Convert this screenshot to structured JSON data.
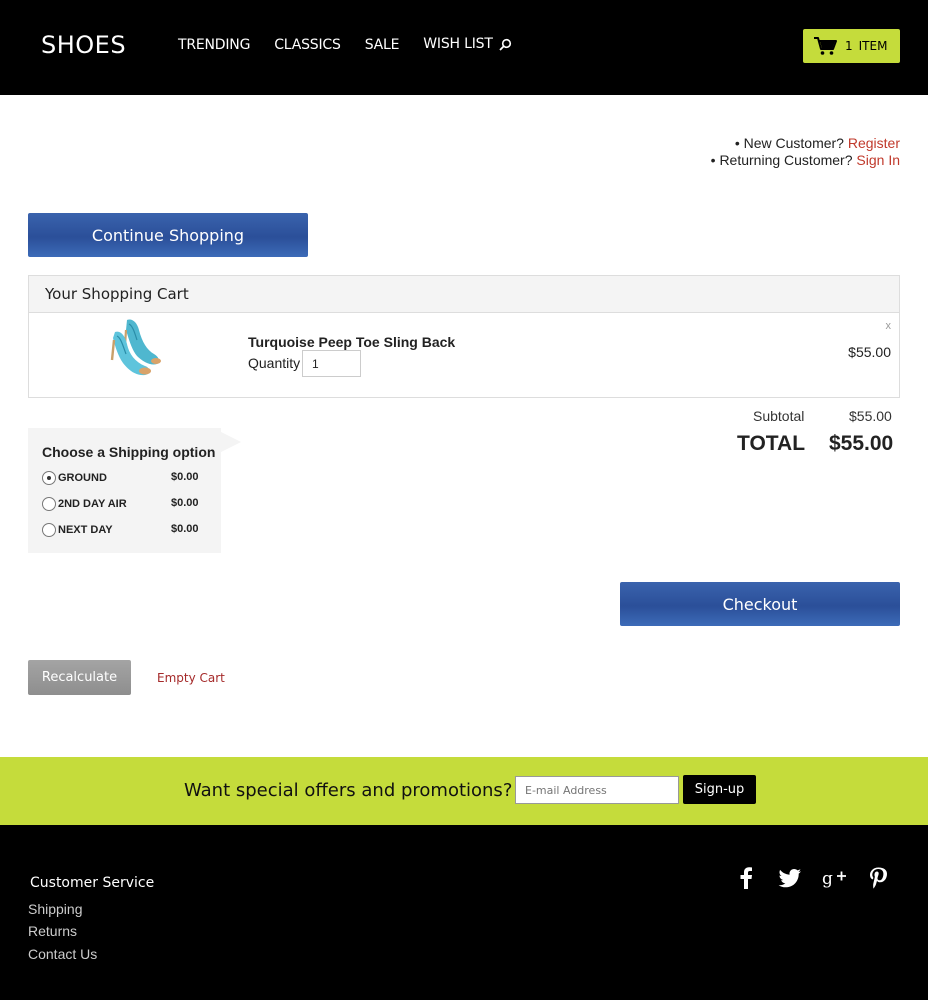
{
  "header": {
    "logo": "SHOES",
    "nav": [
      "TRENDING",
      "CLASSICS",
      "SALE",
      "WISH LIST"
    ],
    "cart_count": "1",
    "cart_label": "ITEM",
    "accent_color": "#c5dc3b"
  },
  "account": {
    "new_prefix": "• New Customer?",
    "register": "Register",
    "returning_prefix": "• Returning Customer?",
    "sign_in": "Sign In"
  },
  "buttons": {
    "continue": "Continue Shopping",
    "checkout": "Checkout",
    "recalculate": "Recalculate",
    "empty_cart": "Empty Cart"
  },
  "cart": {
    "title": "Your Shopping Cart",
    "item": {
      "name": "Turquoise Peep Toe Sling Back",
      "quantity_label": "Quantity",
      "quantity": "1",
      "price": "$55.00",
      "remove": "x"
    },
    "subtotal_label": "Subtotal",
    "subtotal": "$55.00",
    "total_label": "TOTAL",
    "total": "$55.00"
  },
  "shipping": {
    "title": "Choose a Shipping option",
    "options": [
      {
        "name": "GROUND",
        "price": "$0.00",
        "selected": true
      },
      {
        "name": "2ND DAY AIR",
        "price": "$0.00",
        "selected": false
      },
      {
        "name": "NEXT DAY",
        "price": "$0.00",
        "selected": false
      }
    ]
  },
  "promo": {
    "text": "Want special offers and promotions?",
    "placeholder": "E-mail Address",
    "signup": "Sign-up"
  },
  "footer": {
    "title": "Customer Service",
    "links": [
      "Shipping",
      "Returns",
      "Contact Us"
    ],
    "social": [
      "facebook-icon",
      "twitter-icon",
      "google-plus-icon",
      "pinterest-icon"
    ]
  }
}
